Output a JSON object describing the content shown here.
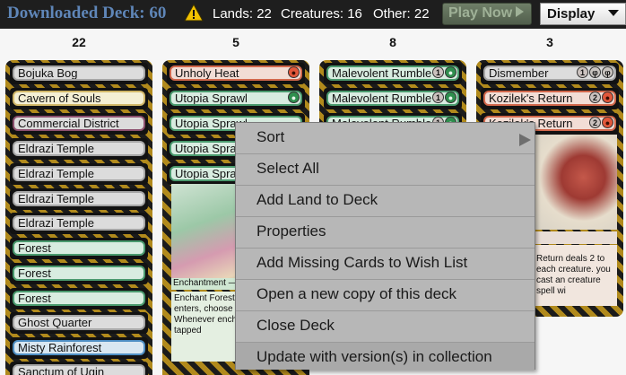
{
  "header": {
    "deck_title": "Downloaded Deck: 60",
    "warning_icon": "warning-icon",
    "lands_label": "Lands: 22",
    "creatures_label": "Creatures: 16",
    "other_label": "Other: 22",
    "play_now_label": "Play Now",
    "display_label": "Display"
  },
  "columns": [
    {
      "count": "22",
      "cards": [
        {
          "name": "Bojuka Bog",
          "color": "gray"
        },
        {
          "name": "Cavern of Souls",
          "color": "gold"
        },
        {
          "name": "Commercial District",
          "color": "multi"
        },
        {
          "name": "Eldrazi Temple",
          "color": "gray"
        },
        {
          "name": "Eldrazi Temple",
          "color": "gray"
        },
        {
          "name": "Eldrazi Temple",
          "color": "gray"
        },
        {
          "name": "Eldrazi Temple",
          "color": "gray"
        },
        {
          "name": "Forest",
          "color": "green"
        },
        {
          "name": "Forest",
          "color": "green"
        },
        {
          "name": "Forest",
          "color": "green"
        },
        {
          "name": "Ghost Quarter",
          "color": "gray"
        },
        {
          "name": "Misty Rainforest",
          "color": "blue"
        },
        {
          "name": "Sanctum of Ugin",
          "color": "gray"
        }
      ]
    },
    {
      "count": "5",
      "cards": [
        {
          "name": "Unholy Heat",
          "color": "red",
          "mana": [
            "r"
          ]
        },
        {
          "name": "Utopia Sprawl",
          "color": "green",
          "mana": [
            "g"
          ]
        },
        {
          "name": "Utopia Sprawl",
          "color": "green",
          "mana": []
        },
        {
          "name": "Utopia Sprawl",
          "color": "green",
          "mana": []
        },
        {
          "name": "Utopia Sprawl",
          "color": "green",
          "mana": []
        }
      ],
      "detail": {
        "type_line": "Enchantment — Aura",
        "rules_text": "Enchant Forest\nAs this Aura enters, choose a color.\nWhenever enchanted Forest is tapped"
      }
    },
    {
      "count": "8",
      "cards": [
        {
          "name": "Malevolent Rumble",
          "color": "green",
          "mana": [
            "1",
            "g"
          ]
        },
        {
          "name": "Malevolent Rumble",
          "color": "green",
          "mana": [
            "1",
            "g"
          ]
        },
        {
          "name": "Malevolent Rumble",
          "color": "green",
          "mana": [
            "1",
            "g"
          ]
        }
      ]
    },
    {
      "count": "3",
      "cards": [
        {
          "name": "Dismember",
          "color": "gray",
          "mana": [
            "1",
            "c",
            "c"
          ]
        },
        {
          "name": "Kozilek's Return",
          "color": "red",
          "mana": [
            "2",
            "r"
          ]
        },
        {
          "name": "Kozilek's Return",
          "color": "red",
          "mana": [
            "2",
            "r"
          ]
        }
      ],
      "detail": {
        "rules_text": "Return deals 2 to each creature. you cast an creature spell wi"
      }
    }
  ],
  "context_menu": {
    "items": [
      {
        "label": "Sort",
        "submenu": true
      },
      {
        "label": "Select All"
      },
      {
        "label": "Add Land to Deck"
      },
      {
        "label": "Properties"
      },
      {
        "label": "Add Missing Cards to Wish List"
      },
      {
        "label": "Open a new copy of this deck"
      },
      {
        "label": "Close Deck"
      },
      {
        "label": "Update with version(s) in collection"
      }
    ]
  }
}
